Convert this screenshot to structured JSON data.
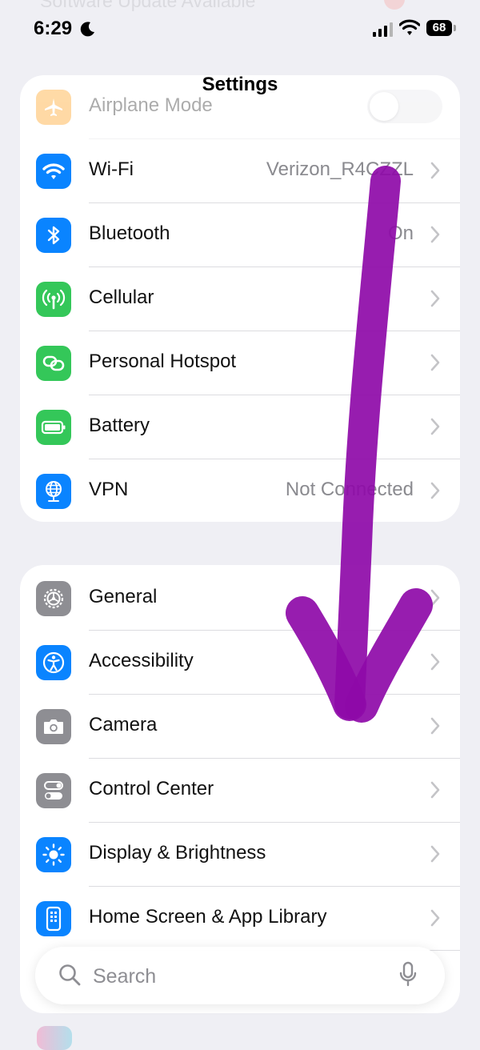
{
  "status_bar": {
    "time": "6:29",
    "battery": "68",
    "background_banner": "Software Update Available"
  },
  "nav": {
    "title": "Settings"
  },
  "connectivity": [
    {
      "label": "Airplane Mode",
      "icon": "airplane-icon",
      "color": "#ff9500",
      "control": "toggle",
      "toggle_on": false
    },
    {
      "label": "Wi-Fi",
      "value": "Verizon_R4CZZL",
      "icon": "wifi-icon",
      "color": "#0a84ff"
    },
    {
      "label": "Bluetooth",
      "value": "On",
      "icon": "bluetooth-icon",
      "color": "#0a84ff"
    },
    {
      "label": "Cellular",
      "icon": "antenna-icon",
      "color": "#34c759"
    },
    {
      "label": "Personal Hotspot",
      "icon": "link-icon",
      "color": "#34c759"
    },
    {
      "label": "Battery",
      "icon": "battery-icon",
      "color": "#34c759"
    },
    {
      "label": "VPN",
      "value": "Not Connected",
      "icon": "globe-icon",
      "color": "#0a84ff"
    }
  ],
  "system": [
    {
      "label": "General",
      "icon": "gear-icon",
      "color": "#8e8e93"
    },
    {
      "label": "Accessibility",
      "icon": "accessibility-icon",
      "color": "#0a84ff"
    },
    {
      "label": "Camera",
      "icon": "camera-icon",
      "color": "#8e8e93"
    },
    {
      "label": "Control Center",
      "icon": "switches-icon",
      "color": "#8e8e93"
    },
    {
      "label": "Display & Brightness",
      "icon": "sun-icon",
      "color": "#0a84ff"
    },
    {
      "label": "Home Screen & App Library",
      "icon": "phone-grid-icon",
      "color": "#0a84ff"
    }
  ],
  "search": {
    "placeholder": "Search"
  },
  "annotation": {
    "color": "#8e0aa8",
    "type": "hand-drawn-down-arrow"
  }
}
